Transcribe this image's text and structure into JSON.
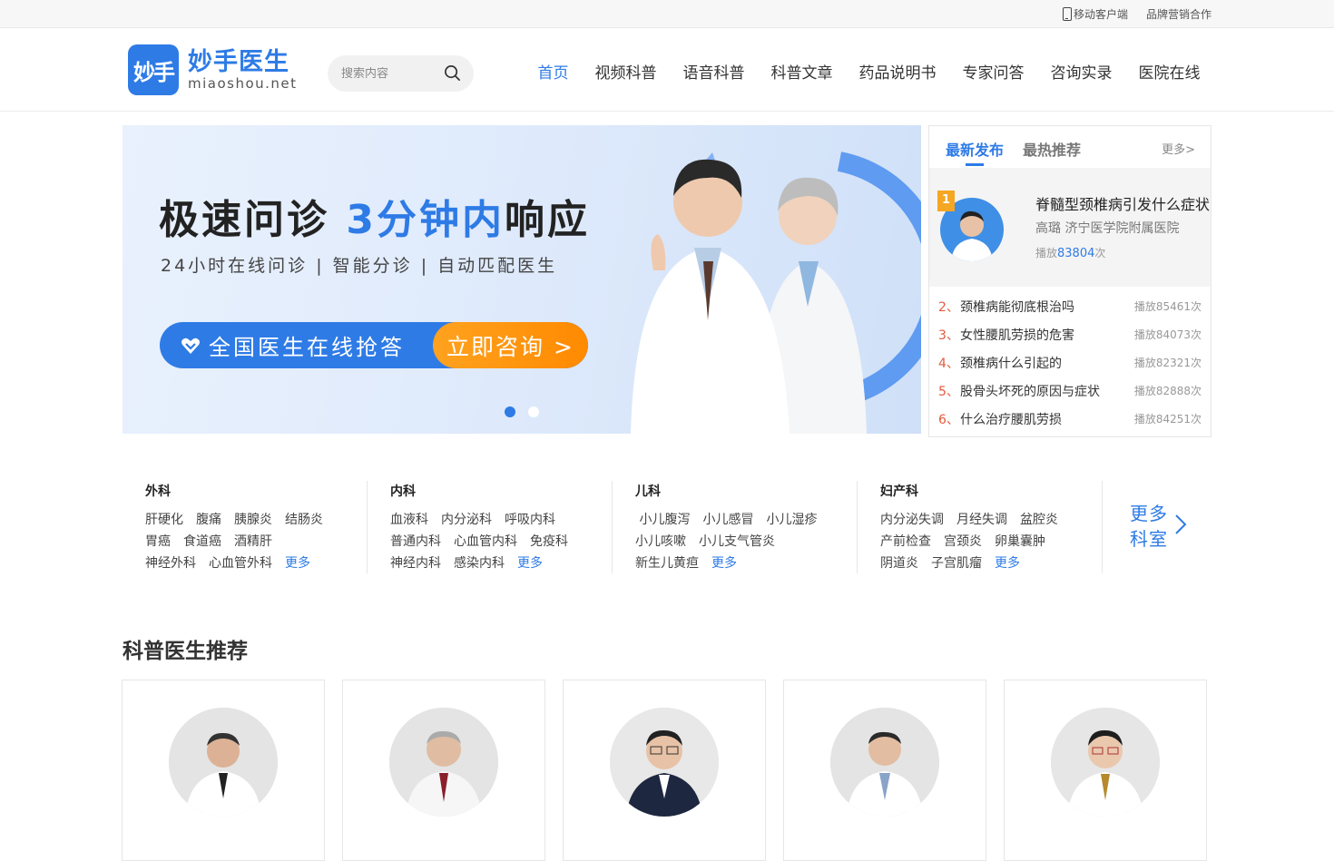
{
  "topbar": {
    "mobile": "移动客户端",
    "brand": "品牌营销合作"
  },
  "logo": {
    "mark": "妙手",
    "name": "妙手医生",
    "domain": "miaoshou.net"
  },
  "search": {
    "placeholder": "搜索内容"
  },
  "nav": [
    "首页",
    "视频科普",
    "语音科普",
    "科普文章",
    "药品说明书",
    "专家问答",
    "咨询实录",
    "医院在线"
  ],
  "banner": {
    "title_a": "极速问诊 ",
    "title_b": "3分钟内",
    "title_c": "响应",
    "subtitle": "24小时在线问诊 | 智能分诊 | 自动匹配医生",
    "cta_text": "全国医生在线抢答",
    "cta_button": "立即咨询 >"
  },
  "panel": {
    "tab_latest": "最新发布",
    "tab_hot": "最热推荐",
    "more": "更多>",
    "featured": {
      "rank": "1",
      "title": "脊髓型颈椎病引发什么症状",
      "doctor": "高璐  济宁医学院附属医院",
      "plays_prefix": "播放",
      "plays": "83804",
      "plays_suffix": "次"
    },
    "list": [
      {
        "num": "2、",
        "title": "颈椎病能彻底根治吗",
        "plays": "播放85461次"
      },
      {
        "num": "3、",
        "title": "女性腰肌劳损的危害",
        "plays": "播放84073次"
      },
      {
        "num": "4、",
        "title": "颈椎病什么引起的",
        "plays": "播放82321次"
      },
      {
        "num": "5、",
        "title": "股骨头坏死的原因与症状",
        "plays": "播放82888次"
      },
      {
        "num": "6、",
        "title": "什么治疗腰肌劳损",
        "plays": "播放84251次"
      }
    ]
  },
  "departments": [
    {
      "name": "外科",
      "lines": [
        [
          "肝硬化",
          "腹痛",
          "胰腺炎",
          "结肠炎"
        ],
        [
          "胃癌",
          "食道癌",
          "酒精肝"
        ],
        [
          "神经外科",
          "心血管外科"
        ]
      ],
      "more": "更多"
    },
    {
      "name": "内科",
      "lines": [
        [
          "血液科",
          "内分泌科",
          "呼吸内科"
        ],
        [
          "普通内科",
          "心血管内科",
          "免疫科"
        ],
        [
          "神经内科",
          "感染内科"
        ]
      ],
      "more": "更多"
    },
    {
      "name": "儿科",
      "lines": [
        [
          "小儿腹泻",
          "小儿感冒",
          "小儿湿疹"
        ],
        [
          "小儿咳嗽",
          "小儿支气管炎"
        ],
        [
          "新生儿黄疸"
        ]
      ],
      "more": "更多"
    },
    {
      "name": "妇产科",
      "lines": [
        [
          "内分泌失调",
          "月经失调",
          "盆腔炎"
        ],
        [
          "产前检查",
          "宫颈炎",
          "卵巢囊肿"
        ],
        [
          "阴道炎",
          "子宫肌瘤"
        ]
      ],
      "more": "更多"
    }
  ],
  "more_departments": {
    "line1": "更多",
    "line2": "科室"
  },
  "doctors_section": {
    "title": "科普医生推荐"
  },
  "colors": {
    "accent": "#2e7be6",
    "orange": "#ff8a00",
    "rank_red": "#e55a3c"
  }
}
